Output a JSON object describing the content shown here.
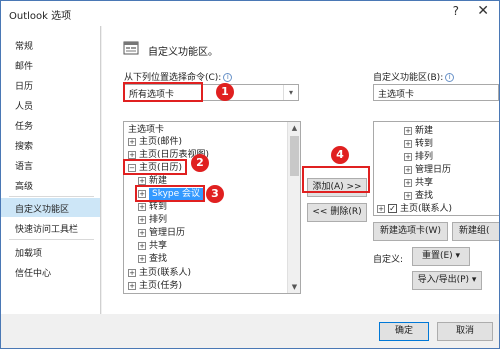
{
  "window": {
    "title": "Outlook 选项",
    "help_glyph": "?",
    "close_glyph": "✕"
  },
  "sidebar": {
    "items": [
      {
        "label": "常规"
      },
      {
        "label": "邮件"
      },
      {
        "label": "日历"
      },
      {
        "label": "人员"
      },
      {
        "label": "任务"
      },
      {
        "label": "搜索"
      },
      {
        "label": "语言"
      },
      {
        "label": "高级"
      },
      {
        "label": "自定义功能区"
      },
      {
        "label": "快速访问工具栏"
      },
      {
        "label": "加载项"
      },
      {
        "label": "信任中心"
      }
    ],
    "active_index": 8
  },
  "header": {
    "title": "自定义功能区。"
  },
  "left": {
    "label": "从下列位置选择命令(C):",
    "select_value": "所有选项卡",
    "tree": [
      {
        "text": "主选项卡",
        "indent": 0,
        "expander": ""
      },
      {
        "text": "主页(邮件)",
        "indent": 1,
        "expander": "+"
      },
      {
        "text": "主页(日历表视图)",
        "indent": 1,
        "expander": "+"
      },
      {
        "text": "主页(日历)",
        "indent": 1,
        "expander": "−"
      },
      {
        "text": "新建",
        "indent": 2,
        "expander": "+"
      },
      {
        "text": "Skype 会议",
        "indent": 2,
        "expander": "+"
      },
      {
        "text": "转到",
        "indent": 2,
        "expander": "+"
      },
      {
        "text": "排列",
        "indent": 2,
        "expander": "+"
      },
      {
        "text": "管理日历",
        "indent": 2,
        "expander": "+"
      },
      {
        "text": "共享",
        "indent": 2,
        "expander": "+"
      },
      {
        "text": "查找",
        "indent": 2,
        "expander": "+"
      },
      {
        "text": "主页(联系人)",
        "indent": 1,
        "expander": "+"
      },
      {
        "text": "主页(任务)",
        "indent": 1,
        "expander": "+"
      }
    ]
  },
  "middle": {
    "add_button": "添加(A) >>",
    "remove_button": "<< 删除(R)"
  },
  "right": {
    "label": "自定义功能区(B):",
    "select_value": "主选项卡",
    "tree": [
      {
        "text": "新建",
        "indent": 1,
        "expander": "+",
        "checkbox": false
      },
      {
        "text": "转到",
        "indent": 1,
        "expander": "+",
        "checkbox": false
      },
      {
        "text": "排列",
        "indent": 1,
        "expander": "+",
        "checkbox": false
      },
      {
        "text": "管理日历",
        "indent": 1,
        "expander": "+",
        "checkbox": false
      },
      {
        "text": "共享",
        "indent": 1,
        "expander": "+",
        "checkbox": false
      },
      {
        "text": "查找",
        "indent": 1,
        "expander": "+",
        "checkbox": false
      },
      {
        "text": "主页(联系人)",
        "indent": 0,
        "expander": "+",
        "checkbox": true
      }
    ],
    "new_tab_button": "新建选项卡(W)",
    "new_group_button": "新建组(",
    "customize_label": "自定义:",
    "reset_button": "重置(E) ▾",
    "import_export_button": "导入/导出(P) ▾"
  },
  "footer": {
    "ok_button": "确定",
    "cancel_button": "取消"
  },
  "callouts": [
    "1",
    "2",
    "3",
    "4"
  ],
  "colors": {
    "callout": "#e02020",
    "selection": "#3399ff",
    "active_nav": "#cde6f7"
  }
}
